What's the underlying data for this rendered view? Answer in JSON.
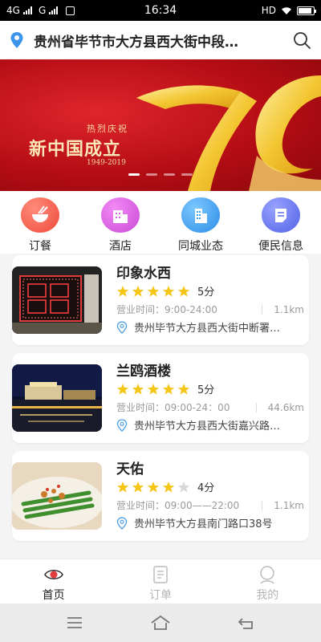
{
  "status_bar": {
    "network_1": "4G",
    "network_2": "G",
    "time": "16:34",
    "hd": "HD"
  },
  "header": {
    "location": "贵州省毕节市大方县西大街中段…",
    "location_icon": "location-pin-icon",
    "search_icon": "search-icon"
  },
  "banner": {
    "line1": "热烈庆祝",
    "line2": "新中国成立",
    "line3": "1949-2019",
    "slide_count": 4,
    "active_slide": 1
  },
  "categories": [
    {
      "label": "订餐",
      "icon": "bowl-icon",
      "color": "#f25a4a"
    },
    {
      "label": "酒店",
      "icon": "hotel-icon",
      "color": "#d657e0"
    },
    {
      "label": "同城业态",
      "icon": "building-icon",
      "color": "#3a9fec"
    },
    {
      "label": "便民信息",
      "icon": "document-icon",
      "color": "#6574ee"
    }
  ],
  "shops": [
    {
      "name": "印象水西",
      "rating": 5,
      "score": "5分",
      "hours": "营业时间：9:00-24:00",
      "distance": "1.1km",
      "address": "贵州毕节大方县西大街中断署…"
    },
    {
      "name": "兰鸥酒楼",
      "rating": 5,
      "score": "5分",
      "hours": "营业时间：09:00-24：00",
      "distance": "44.6km",
      "address": "贵州毕节大方县西大街嘉兴路…"
    },
    {
      "name": "天佑",
      "rating": 4,
      "score": "4分",
      "hours": "营业时间：09:00——22:00",
      "distance": "1.1km",
      "address": "贵州毕节大方县南门路口38号"
    }
  ],
  "tabs": [
    {
      "label": "首页",
      "icon": "eye-icon",
      "active": true
    },
    {
      "label": "订单",
      "icon": "order-icon",
      "active": false
    },
    {
      "label": "我的",
      "icon": "profile-icon",
      "active": false
    }
  ],
  "colors": {
    "accent_star": "#f5c518",
    "star_empty": "#d8d8d8",
    "banner_red": "#c0141b",
    "gold": "#f0c23a"
  }
}
